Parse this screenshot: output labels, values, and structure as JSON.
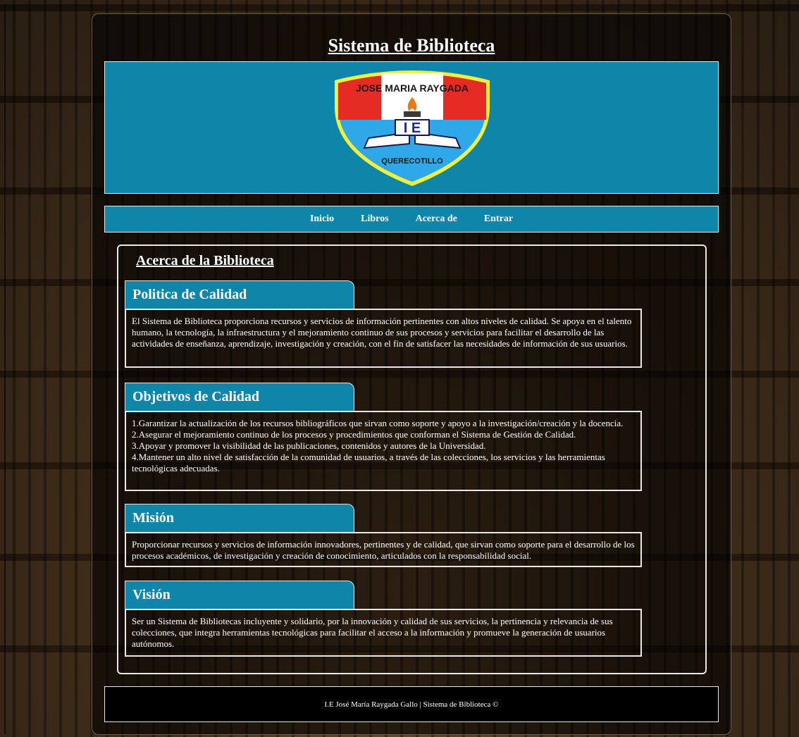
{
  "site": {
    "title": "Sistema de Biblioteca"
  },
  "logo": {
    "top_text": "JOSE MARIA RAYGADA",
    "initials": "I E",
    "bottom_text": "QUERECOTILLO"
  },
  "nav": {
    "items": [
      {
        "label": "Inicio"
      },
      {
        "label": "Libros"
      },
      {
        "label": "Acerca de"
      },
      {
        "label": "Entrar"
      }
    ]
  },
  "content": {
    "title": "Acerca de la Biblioteca",
    "sections": [
      {
        "heading": "Politica de Calidad",
        "lines": [
          "El Sistema de Biblioteca proporciona recursos y servicios de información pertinentes con altos niveles de calidad. Se apoya en el talento humano, la tecnología, la infraestructura y el mejoramiento continuo de sus procesos y servicios para facilitar el desarrollo de las actividades de enseñanza, aprendizaje, investigación y creación, con el fin de satisfacer las necesidades de información de sus usuarios."
        ]
      },
      {
        "heading": "Objetivos de Calidad",
        "lines": [
          "1.Garantizar la actualización de los recursos bibliográficos que sirvan como soporte y apoyo a la investigación/creación y la docencia.",
          "2.Asegurar el mejoramiento continuo de los procesos y procedimientos que conforman el Sistema de Gestión de Calidad.",
          "3.Apoyar y promover la visibilidad de las publicaciones, contenidos y autores de la Universidad.",
          "4.Mantener un alto nivel de satisfacción de la comunidad de usuarios, a través de las colecciones, los servicios y las herramientas tecnológicas adecuadas."
        ]
      },
      {
        "heading": "Misión",
        "lines": [
          "Proporcionar recursos y servicios de información innovadores, pertinentes y de calidad, que sirvan como soporte para el desarrollo de los procesos académicos, de investigación y creación de conocimiento, articulados con la responsabilidad social."
        ]
      },
      {
        "heading": "Visión",
        "lines": [
          "Ser un Sistema de Bibliotecas incluyente y solidario, por la innovación y calidad de sus servicios, la pertinencia y relevancia de sus colecciones, que integra herramientas tecnológicas para facilitar el acceso a la información y promueve la generación de usuarios autónomos."
        ]
      }
    ]
  },
  "footer": {
    "text": "I.E José María Raygada Gallo | Sistema de Biblioteca ©"
  },
  "colors": {
    "accent": "#0e86aa",
    "panel": "#000000",
    "text": "#ffffff"
  }
}
